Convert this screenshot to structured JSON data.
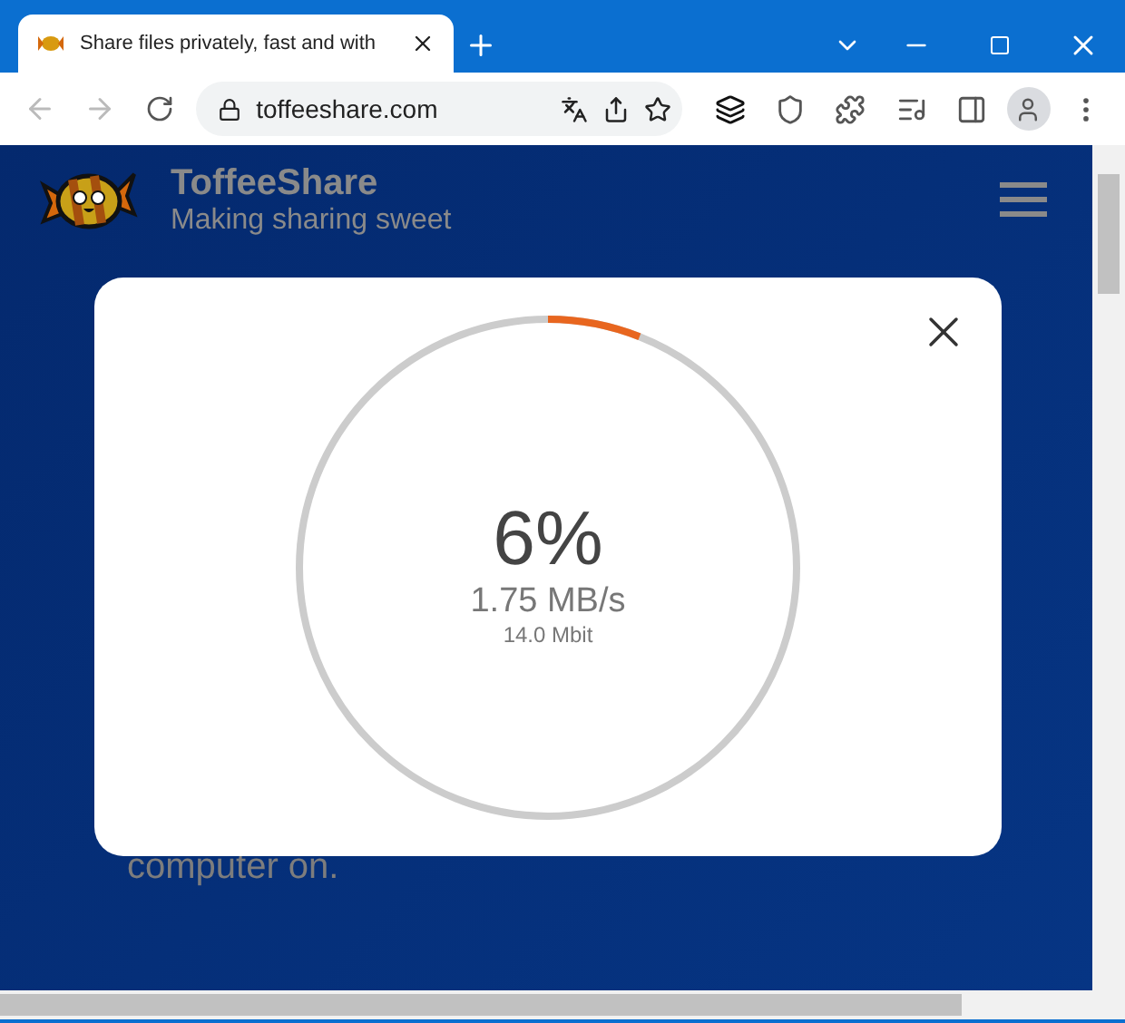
{
  "browser": {
    "tab_title": "Share files privately, fast and with",
    "url": "toffeeshare.com"
  },
  "site": {
    "brand": "ToffeeShare",
    "tagline": "Making sharing sweet",
    "body_text": "computer on."
  },
  "dialog": {
    "level": 0.06,
    "percent": "6%",
    "speed": "1.75 MB/s",
    "amount": "14.0 Mbit"
  }
}
